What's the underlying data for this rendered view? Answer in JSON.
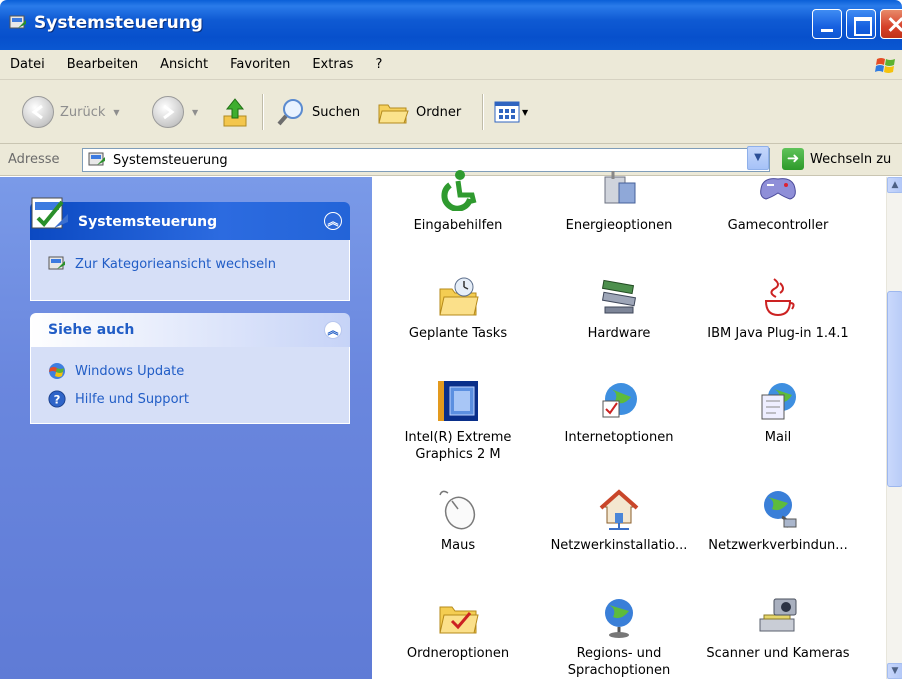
{
  "window": {
    "title": "Systemsteuerung"
  },
  "menu": [
    "Datei",
    "Bearbeiten",
    "Ansicht",
    "Favoriten",
    "Extras",
    "?"
  ],
  "toolbar": {
    "back_label": "Zurück",
    "search_label": "Suchen",
    "folders_label": "Ordner"
  },
  "address": {
    "label": "Adresse",
    "value": "Systemsteuerung",
    "go_label": "Wechseln zu"
  },
  "taskpane": {
    "main_box": {
      "title": "Systemsteuerung",
      "links": [
        "Zur Kategorieansicht wechseln"
      ]
    },
    "see_also": {
      "title": "Siehe auch",
      "links": [
        "Windows Update",
        "Hilfe und Support"
      ]
    }
  },
  "items": [
    {
      "label": "Eingabehilfen",
      "icon": "accessibility-icon"
    },
    {
      "label": "Energieoptionen",
      "icon": "power-options-icon"
    },
    {
      "label": "Gamecontroller",
      "icon": "gamepad-icon"
    },
    {
      "label": "Geplante Tasks",
      "icon": "scheduled-tasks-icon"
    },
    {
      "label": "Hardware",
      "icon": "hardware-icon"
    },
    {
      "label": "IBM Java Plug-in 1.4.1",
      "icon": "java-icon"
    },
    {
      "label": "Intel(R) Extreme Graphics 2 M",
      "icon": "intel-graphics-icon"
    },
    {
      "label": "Internetoptionen",
      "icon": "internet-options-icon"
    },
    {
      "label": "Mail",
      "icon": "mail-icon"
    },
    {
      "label": "Maus",
      "icon": "mouse-icon"
    },
    {
      "label": "Netzwerkinstallatio...",
      "icon": "network-setup-icon"
    },
    {
      "label": "Netzwerkverbindun...",
      "icon": "network-connections-icon"
    },
    {
      "label": "Ordneroptionen",
      "icon": "folder-options-icon"
    },
    {
      "label": "Regions- und Sprachoptionen",
      "icon": "regional-options-icon"
    },
    {
      "label": "Scanner und Kameras",
      "icon": "scanner-camera-icon"
    }
  ],
  "colors": {
    "titlebar": "#0a58d2",
    "taskpane": "#6a87de",
    "link": "#215dc6"
  }
}
